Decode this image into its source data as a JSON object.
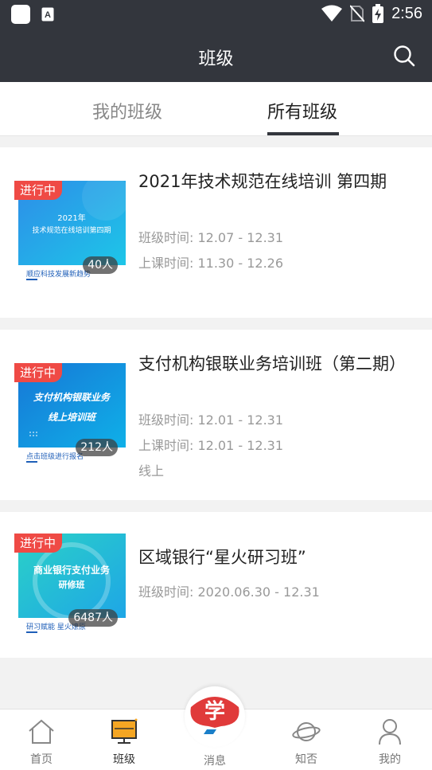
{
  "status_bar": {
    "time": "2:56",
    "icons": [
      "app-square-icon",
      "keyboard-a-icon",
      "wifi-icon",
      "no-sim-icon",
      "battery-charging-icon"
    ]
  },
  "app_bar": {
    "title": "班级",
    "search_icon": "search-icon"
  },
  "tabs": [
    {
      "label": "我的班级",
      "active": false
    },
    {
      "label": "所有班级",
      "active": true
    }
  ],
  "classes": [
    {
      "title": "2021年技术规范在线培训 第四期",
      "status": "进行中",
      "count": "40人",
      "thumb_text": [
        "2021年",
        "技术规范在线培训第四期"
      ],
      "thumb_caption": "顺应科技发展新趋势",
      "meta": [
        "班级时间: 12.07 - 12.31",
        "上课时间: 11.30 - 12.26"
      ]
    },
    {
      "title": "支付机构银联业务培训班（第二期）",
      "status": "进行中",
      "count": "212人",
      "thumb_text": [
        "支付机构银联业务",
        "线上培训班"
      ],
      "thumb_caption": "点击班级进行报名",
      "meta": [
        "班级时间: 12.01 - 12.31",
        "上课时间: 12.01 - 12.31",
        "线上"
      ]
    },
    {
      "title": "区域银行“星火研习班”",
      "status": "进行中",
      "count": "6487人",
      "thumb_text": [
        "商业银行支付业务",
        "研修班"
      ],
      "thumb_caption": "研习赋能 星火燎原",
      "meta": [
        "班级时间: 2020.06.30 - 12.31"
      ]
    }
  ],
  "bottom_nav": [
    {
      "label": "首页",
      "icon": "home-icon",
      "active": false
    },
    {
      "label": "班级",
      "icon": "class-monitor-icon",
      "active": true
    },
    {
      "label": "消息",
      "icon": "xue-logo-icon",
      "active": false,
      "logo_char": "学"
    },
    {
      "label": "知否",
      "icon": "planet-icon",
      "active": false
    },
    {
      "label": "我的",
      "icon": "person-icon",
      "active": false
    }
  ],
  "colors": {
    "header_bg": "#33363d",
    "status_badge": "#ef4a45",
    "active_nav": "#f5a623",
    "logo_red": "#e03a3a"
  }
}
